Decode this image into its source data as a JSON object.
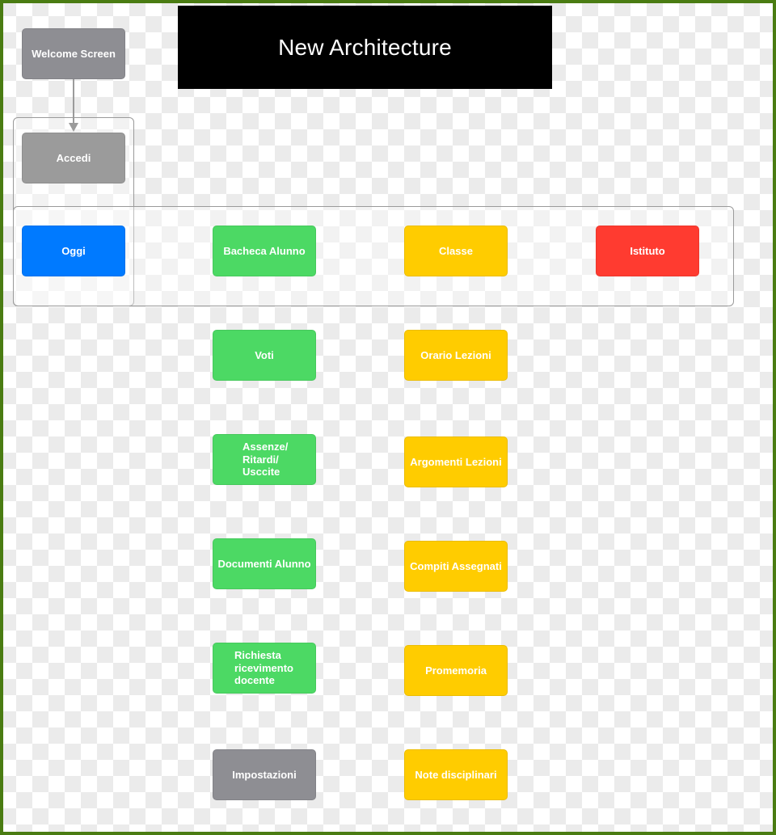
{
  "title": "New Architecture",
  "colors": {
    "border": "#4a7c12",
    "neutral": "#8e8e93",
    "primary": "#007aff",
    "student": "#4cd964",
    "class": "#ffcc00",
    "institute": "#ff3b30"
  },
  "nodes": {
    "welcome": "Welcome Screen",
    "accedi": "Accedi",
    "oggi": "Oggi",
    "bacheca": "Bacheca Alunno",
    "classe": "Classe",
    "istituto": "Istituto",
    "voti": "Voti",
    "assenze": "Assenze/\nRitardi/\nUsccite",
    "documenti": "Documenti Alunno",
    "richiesta": "Richiesta\nricevimento\ndocente",
    "impostazioni": "Impostazioni",
    "orario": "Orario Lezioni",
    "argomenti": "Argomenti Lezioni",
    "compiti": "Compiti Assegnati",
    "promemoria": "Promemoria",
    "note": "Note disciplinari"
  },
  "edges": [
    {
      "from": "Welcome Screen",
      "to": "Accedi"
    }
  ]
}
